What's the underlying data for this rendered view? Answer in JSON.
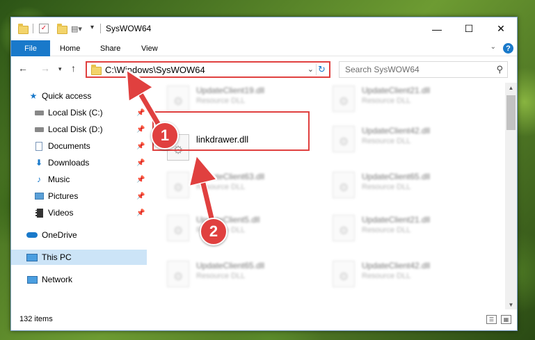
{
  "window": {
    "title": "SysWOW64",
    "minimize": "—",
    "maximize": "☐",
    "close": "✕"
  },
  "ribbon": {
    "tabs": [
      "File",
      "Home",
      "Share",
      "View"
    ]
  },
  "nav": {
    "address": "C:\\Windows\\SysWOW64",
    "search_placeholder": "Search SysWOW64"
  },
  "sidebar": {
    "items": [
      {
        "label": "Quick access",
        "icon": "star-icon"
      },
      {
        "label": "Local Disk (C:)",
        "icon": "drive-icon",
        "pinned": true
      },
      {
        "label": "Local Disk (D:)",
        "icon": "drive-icon",
        "pinned": true
      },
      {
        "label": "Documents",
        "icon": "documents-icon",
        "pinned": true
      },
      {
        "label": "Downloads",
        "icon": "download-icon",
        "pinned": true
      },
      {
        "label": "Music",
        "icon": "music-icon",
        "pinned": true
      },
      {
        "label": "Pictures",
        "icon": "pictures-icon",
        "pinned": true
      },
      {
        "label": "Videos",
        "icon": "videos-icon",
        "pinned": true
      },
      {
        "label": "OneDrive",
        "icon": "cloud-icon"
      },
      {
        "label": "This PC",
        "icon": "computer-icon",
        "selected": true
      },
      {
        "label": "Network",
        "icon": "network-icon"
      }
    ]
  },
  "files": [
    {
      "name": "UpdateClient19.dll",
      "type": "Resource DLL"
    },
    {
      "name": "UpdateClient21.dll",
      "type": "Resource DLL"
    },
    {
      "name": "linkdrawer.dll",
      "type": ""
    },
    {
      "name": "UpdateClient42.dll",
      "type": "Resource DLL"
    },
    {
      "name": "UpdateClient63.dll",
      "type": "Resource DLL"
    },
    {
      "name": "UpdateClient65.dll",
      "type": "Resource DLL"
    },
    {
      "name": "UpdateClient5.dll",
      "type": "Resource DLL"
    },
    {
      "name": "UpdateClient21.dll",
      "type": "Resource DLL"
    },
    {
      "name": "UpdateClient65.dll",
      "type": "Resource DLL"
    },
    {
      "name": "UpdateClient42.dll",
      "type": "Resource DLL"
    }
  ],
  "status": {
    "item_count": "132 items"
  },
  "callouts": [
    "1",
    "2"
  ],
  "colors": {
    "accent": "#1979ca",
    "highlight": "#e0403f"
  }
}
